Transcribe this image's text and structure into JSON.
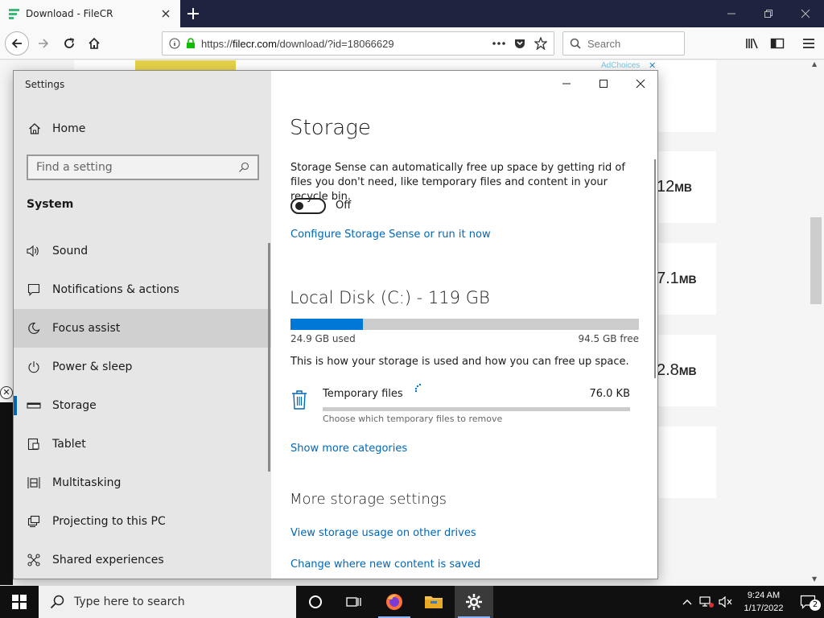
{
  "browser": {
    "tab_title": "Download - FileCR",
    "url_prefix": "https://",
    "url_host": "filecr.com",
    "url_path": "/download/?id=18066629",
    "search_placeholder": "Search"
  },
  "webpage": {
    "ad_choices": "AdChoices",
    "cards": [
      {
        "value": "12",
        "unit": "MB"
      },
      {
        "value": "7.1",
        "unit": "MB"
      },
      {
        "value": "2.8",
        "unit": "MB"
      }
    ]
  },
  "settings": {
    "app_title": "Settings",
    "home_label": "Home",
    "find_placeholder": "Find a setting",
    "section_heading": "System",
    "nav": [
      {
        "label": "Sound",
        "icon": "speaker-icon"
      },
      {
        "label": "Notifications & actions",
        "icon": "notification-icon"
      },
      {
        "label": "Focus assist",
        "icon": "moon-icon"
      },
      {
        "label": "Power & sleep",
        "icon": "power-icon"
      },
      {
        "label": "Storage",
        "icon": "storage-icon"
      },
      {
        "label": "Tablet",
        "icon": "tablet-icon"
      },
      {
        "label": "Multitasking",
        "icon": "multitasking-icon"
      },
      {
        "label": "Projecting to this PC",
        "icon": "projector-icon"
      },
      {
        "label": "Shared experiences",
        "icon": "shared-icon"
      }
    ],
    "main": {
      "title": "Storage",
      "storage_sense_desc": "Storage Sense can automatically free up space by getting rid of files you don't need, like temporary files and content in your recycle bin.",
      "toggle_state": "Off",
      "configure_link": "Configure Storage Sense or run it now",
      "disk_heading": "Local Disk (C:) - 119 GB",
      "used_label": "24.9 GB used",
      "free_label": "94.5 GB free",
      "used_fraction": 0.209,
      "how_text": "This is how your storage is used and how you can free up space.",
      "category": {
        "name": "Temporary files",
        "size": "76.0 KB",
        "subtitle": "Choose which temporary files to remove"
      },
      "show_more": "Show more categories",
      "more_heading": "More storage settings",
      "link_other_drives": "View storage usage on other drives",
      "link_new_content": "Change where new content is saved"
    }
  },
  "taskbar": {
    "search_placeholder": "Type here to search",
    "time": "9:24 AM",
    "date": "1/17/2022",
    "notification_count": "2"
  },
  "colors": {
    "accent": "#0078d7",
    "link": "#0067b8",
    "tabbar": "#202340"
  }
}
